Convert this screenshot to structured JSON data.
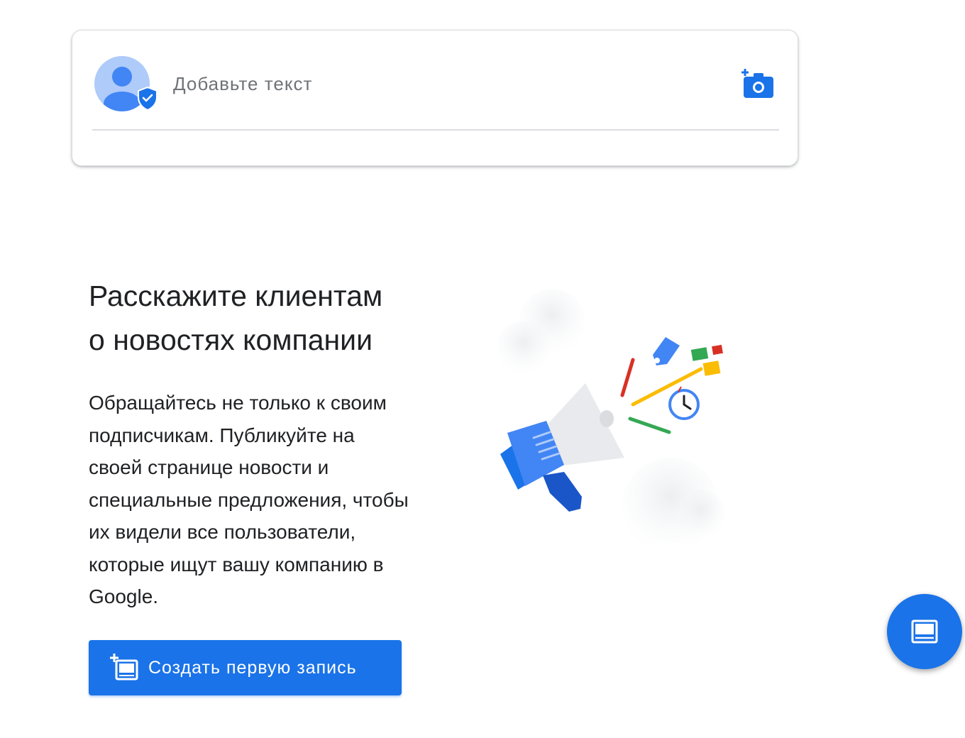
{
  "composer": {
    "placeholder": "Добавьте текст",
    "avatar_icon": "verified-user-avatar-icon",
    "add_photo_icon": "add-photo-camera-icon"
  },
  "promo": {
    "title_lines": [
      "Расскажите клиентам",
      "о новостях компании"
    ],
    "text_lines": [
      "Обращайтесь не только к своим",
      "подписчикам. Публикуйте на",
      "своей странице новости и",
      "специальные предложения, чтобы",
      "их видели все пользователи,",
      "которые ищут вашу компанию в",
      "Google."
    ],
    "cta_label": "Создать первую запись",
    "cta_icon": "add-post-icon",
    "illustration": "megaphone-illustration"
  },
  "fab": {
    "icon": "post-icon"
  },
  "colors": {
    "accent": "#1a73e8",
    "text": "#202124",
    "muted": "#5f6368",
    "divider": "#dadce0"
  }
}
